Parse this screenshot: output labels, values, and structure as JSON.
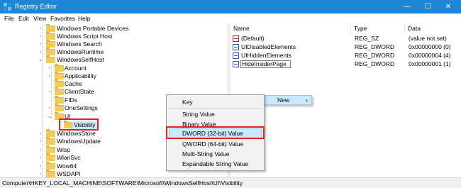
{
  "window": {
    "title": "Registry Editor",
    "minimize": "—",
    "maximize": "☐",
    "close": "✕"
  },
  "menu": [
    "File",
    "Edit",
    "View",
    "Favorites",
    "Help"
  ],
  "tree": [
    {
      "label": "Windows Portable Devices",
      "expanded": false
    },
    {
      "label": "Windows Script Host",
      "expanded": false
    },
    {
      "label": "Windows Search",
      "expanded": false
    },
    {
      "label": "WindowsRuntime",
      "expanded": false
    },
    {
      "label": "WindowsSelfHost",
      "expanded": true
    },
    {
      "label": "Account",
      "expanded": false
    },
    {
      "label": "Applicability",
      "expanded": false
    },
    {
      "label": "Cache",
      "expanded": false
    },
    {
      "label": "ClientState",
      "expanded": false
    },
    {
      "label": "FIDs",
      "expanded": false
    },
    {
      "label": "OneSettings",
      "expanded": false
    },
    {
      "label": "UI",
      "expanded": true
    },
    {
      "label": "Visibility",
      "expanded": false,
      "selected": true
    },
    {
      "label": "WindowsStore",
      "expanded": false
    },
    {
      "label": "WindowsUpdate",
      "expanded": false
    },
    {
      "label": "Wisp",
      "expanded": false
    },
    {
      "label": "WlanSvc",
      "expanded": false
    },
    {
      "label": "Wow64",
      "expanded": false
    },
    {
      "label": "WSDAPI",
      "expanded": false
    }
  ],
  "list": {
    "columns": [
      "Name",
      "Type",
      "Data"
    ],
    "rows": [
      {
        "name": "(Default)",
        "type": "REG_SZ",
        "data": "(value not set)",
        "icon": "string-value-icon"
      },
      {
        "name": "UIDisabledElements",
        "type": "REG_DWORD",
        "data": "0x00000000 (0)",
        "icon": "dword-value-icon"
      },
      {
        "name": "UIHiddenElements",
        "type": "REG_DWORD",
        "data": "0x00000004 (4)",
        "icon": "dword-value-icon"
      },
      {
        "name": "HideInsiderPage",
        "type": "REG_DWORD",
        "data": "0x00000001 (1)",
        "icon": "dword-value-icon",
        "editing": true
      }
    ]
  },
  "new_menu": {
    "label": "New",
    "arrow": "›"
  },
  "submenu": {
    "items": [
      "Key",
      "String Value",
      "Binary Value",
      "DWORD (32-bit) Value",
      "QWORD (64-bit) Value",
      "Multi-String Value",
      "Expandable String Value"
    ],
    "highlighted": "DWORD (32-bit) Value"
  },
  "status": {
    "path": "Computer\\HKEY_LOCAL_MACHINE\\SOFTWARE\\Microsoft\\WindowsSelfHost\\UI\\Visibility"
  },
  "colors": {
    "titlebar": "#1f86d6",
    "highlight_box": "#d9232e",
    "selection": "#cce8ff",
    "folder": "#f1cb5c"
  }
}
